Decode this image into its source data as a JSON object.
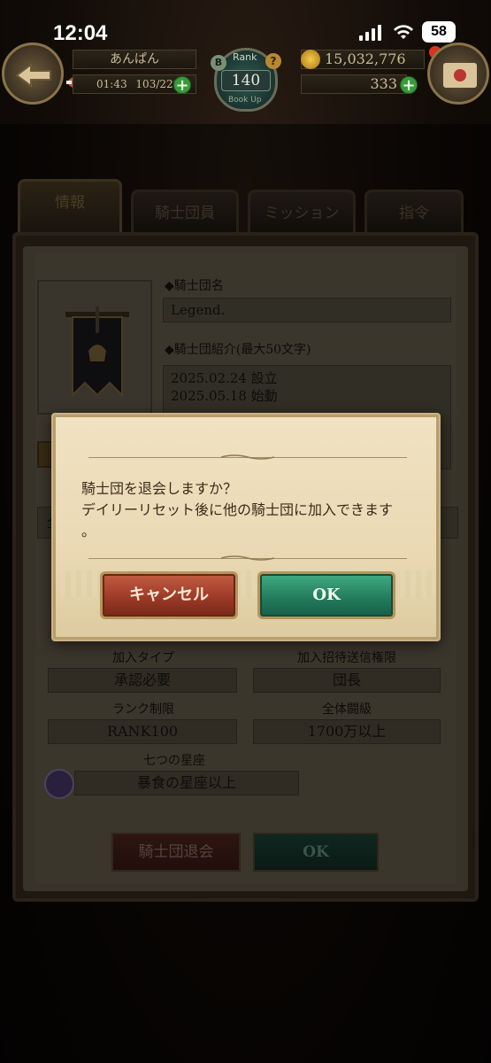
{
  "status_bar": {
    "time": "12:04",
    "battery": "58"
  },
  "hud": {
    "player_name": "あんぱん",
    "stamina_timer": "01:43",
    "stamina": "103/229",
    "rank_label": "Rank",
    "rank_value": "140",
    "rank_sub": "Book Up",
    "rank_b": "B",
    "gold": "15,032,776",
    "gems": "333"
  },
  "tabs": [
    {
      "label": "情報",
      "active": true
    },
    {
      "label": "騎士団員",
      "active": false
    },
    {
      "label": "ミッション",
      "active": false
    },
    {
      "label": "指令",
      "active": false
    }
  ],
  "guild": {
    "name_label": "◆騎士団名",
    "name_value": "Legend.",
    "intro_label": "◆騎士団紹介(最大50文字)",
    "intro_line1": "2025.02.24 設立",
    "intro_line2": "2025.05.18 始動",
    "join_type_label": "加入タイプ",
    "join_type_value": "承認必要",
    "invite_perm_label": "加入招待送信権限",
    "invite_perm_value": "団長",
    "rank_limit_label": "ランク制限",
    "rank_limit_value": "RANK100",
    "total_power_label": "全体闘級",
    "total_power_value": "1700万以上",
    "seven_stars_label": "七つの星座",
    "seven_stars_value": "暴食の星座以上",
    "left_side_char": "全"
  },
  "bottom_buttons": {
    "leave": "騎士団退会",
    "ok": "OK"
  },
  "dialog": {
    "message_line1": "騎士団を退会しますか？",
    "message_line2": "デイリーリセット後に他の騎士団に加入できます",
    "message_line3": "。",
    "cancel": "キャンセル",
    "ok": "OK"
  },
  "colors": {
    "cancel_red": "#9a3826",
    "ok_green": "#227a5a",
    "parchment": "#ead9b4"
  }
}
